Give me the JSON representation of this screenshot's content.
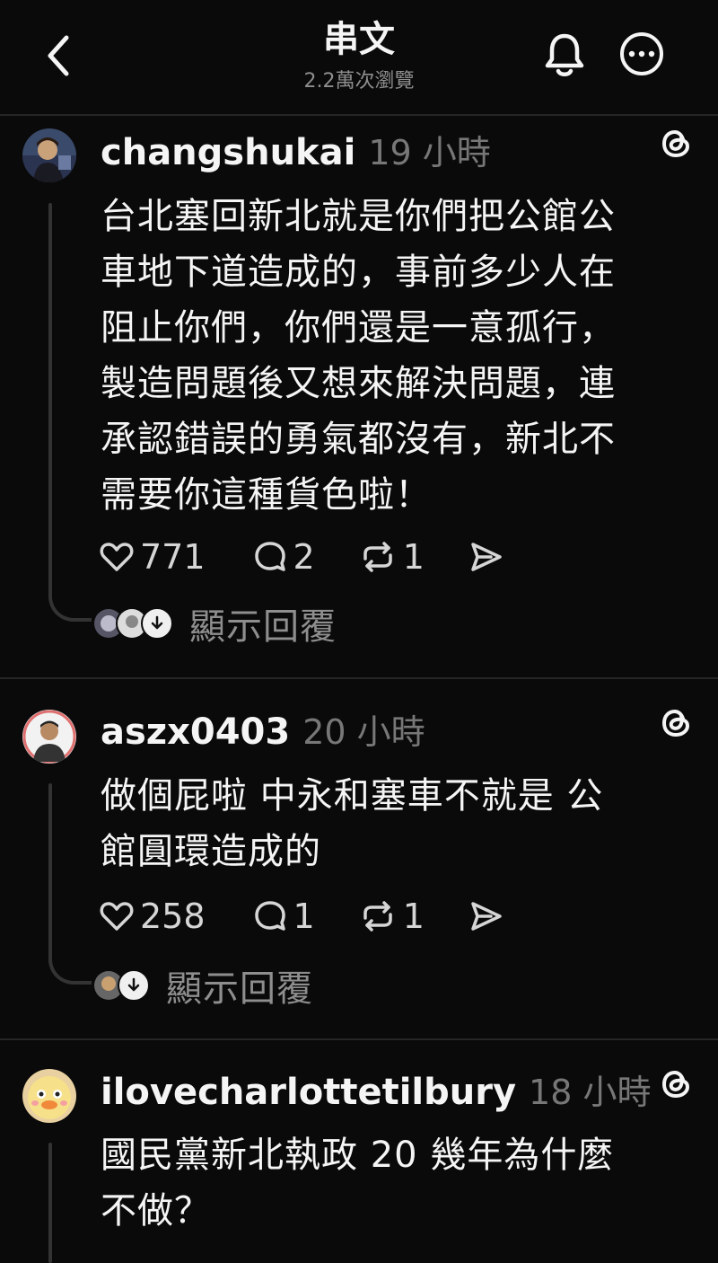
{
  "header": {
    "title": "串文",
    "subtitle": "2.2萬次瀏覽"
  },
  "icons": {
    "back": "chevron-left-icon",
    "notifications": "bell-icon",
    "more": "more-icon",
    "threads": "threads-logo-icon",
    "like": "heart-icon",
    "comment": "comment-icon",
    "repost": "repost-icon",
    "share": "send-icon"
  },
  "colors": {
    "background": "#0a0a0a",
    "text": "#f5f5f5",
    "muted": "#8e8e8e",
    "divider": "#262626"
  },
  "posts": [
    {
      "username": "changshukai",
      "time": "19 小時",
      "lines": [
        "台北塞回新北就是你們把公館公",
        "車地下道造成的，事前多少人在",
        "阻止你們，你們還是一意孤行，",
        "製造問題後又想來解決問題，連",
        "承認錯誤的勇氣都沒有，新北不",
        "需要你這種貨色啦！"
      ],
      "likes": "771",
      "comments": "2",
      "reposts": "1",
      "show_replies": "顯示回覆"
    },
    {
      "username": "aszx0403",
      "time": "20 小時",
      "lines": [
        "做個屁啦 中永和塞車不就是 公",
        "館圓環造成的"
      ],
      "likes": "258",
      "comments": "1",
      "reposts": "1",
      "show_replies": "顯示回覆"
    },
    {
      "username": "ilovecharlottetilbury",
      "time": "18 小時",
      "lines": [
        "國民黨新北執政 20 幾年為什麼",
        "不做？"
      ]
    }
  ]
}
